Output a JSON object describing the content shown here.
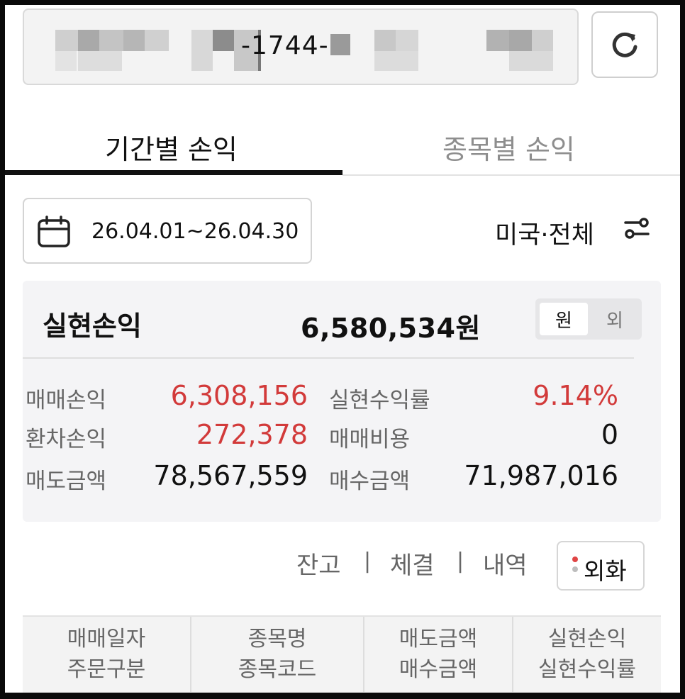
{
  "account": {
    "number_visible": "-1744-"
  },
  "icons": {
    "refresh": "refresh-icon",
    "calendar": "calendar-icon",
    "filter": "filter-settings-icon"
  },
  "tabs": [
    {
      "label": "기간별 손익",
      "active": true
    },
    {
      "label": "종목별 손익",
      "active": false
    }
  ],
  "date_range": "26.04.01~26.04.30",
  "filter_label": "미국·전체",
  "summary": {
    "title": "실현손익",
    "value": "6,580,534원",
    "currency_toggle": {
      "won": "원",
      "foreign": "외",
      "selected": "원"
    },
    "rows": [
      {
        "left_label": "매매손익",
        "left_value": "6,308,156",
        "right_label": "실현수익률",
        "right_value": "9.14%"
      },
      {
        "left_label": "환차손익",
        "left_value": "272,378",
        "right_label": "매매비용",
        "right_value": "0"
      },
      {
        "left_label": "매도금액",
        "left_value": "78,567,559",
        "right_label": "매수금액",
        "right_value": "71,987,016"
      }
    ]
  },
  "links": {
    "balance": "잔고",
    "execution": "체결",
    "history": "내역",
    "separator": "|",
    "fx_button": "외화"
  },
  "colors": {
    "profit_red": "#d23a3a",
    "text_dark": "#111111",
    "text_gray": "#666666",
    "card_bg": "#f4f4f6"
  },
  "table_header": [
    {
      "line1": "매매일자",
      "line2": "주문구분"
    },
    {
      "line1": "종목명",
      "line2": "종목코드"
    },
    {
      "line1": "매도금액",
      "line2": "매수금액"
    },
    {
      "line1": "실현손익",
      "line2": "실현수익률"
    }
  ]
}
